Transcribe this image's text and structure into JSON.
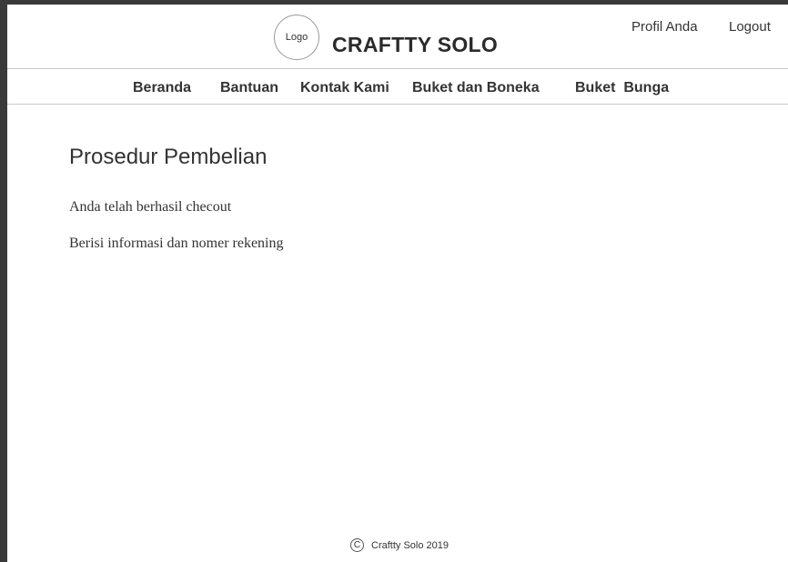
{
  "header": {
    "logo_label": "Logo",
    "brand": "CRAFTTY SOLO",
    "profile_link": "Profil Anda",
    "logout_link": "Logout"
  },
  "nav": {
    "items": [
      "Beranda",
      "Bantuan",
      "Kontak Kami",
      "Buket dan Boneka",
      "Buket  Bunga"
    ]
  },
  "main": {
    "title": "Prosedur Pembelian",
    "paragraphs": [
      "Anda telah berhasil checout",
      "Berisi informasi dan nomer rekening"
    ]
  },
  "footer": {
    "copyright_symbol": "C",
    "text": "Craftty Solo 2019"
  }
}
